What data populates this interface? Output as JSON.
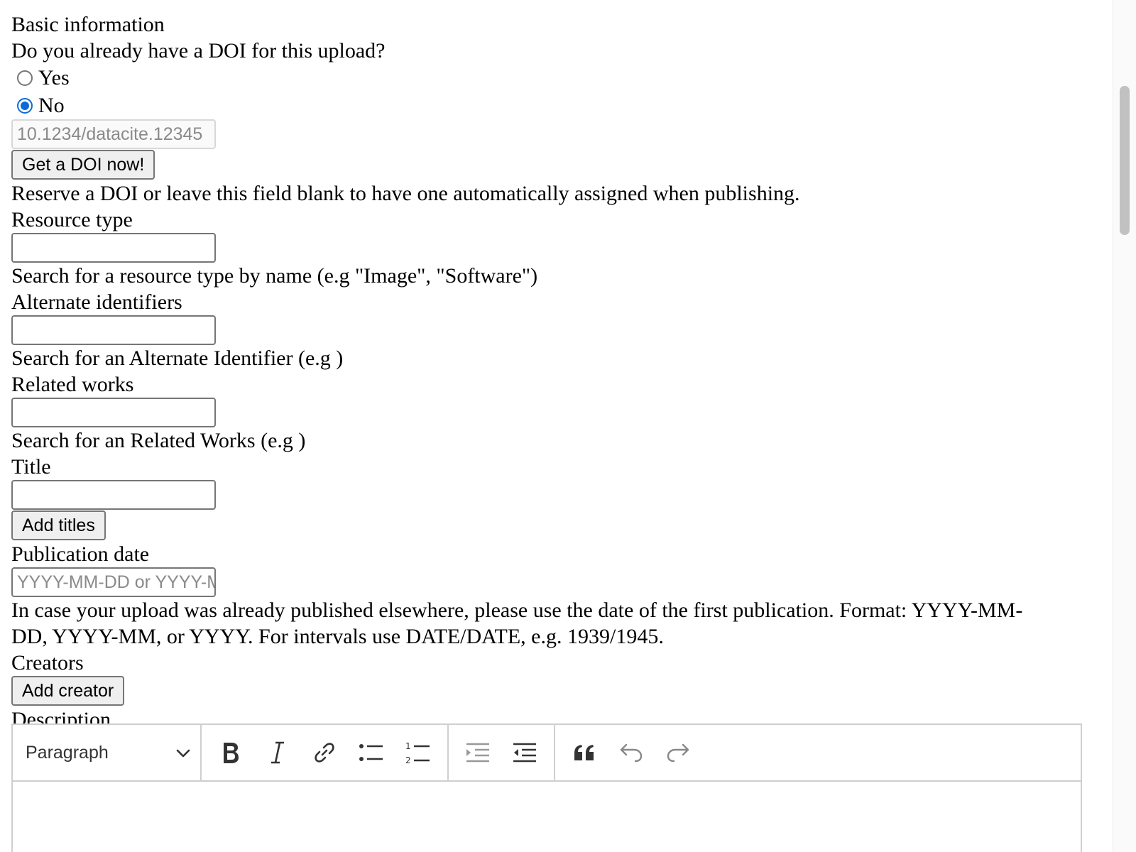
{
  "form": {
    "section_title": "Basic information",
    "doi_question": "Do you already have a DOI for this upload?",
    "doi_options": [
      {
        "label": "Yes",
        "checked": false
      },
      {
        "label": "No",
        "checked": true
      }
    ],
    "doi_placeholder": "10.1234/datacite.12345",
    "get_doi_button": "Get a DOI now!",
    "doi_help": "Reserve a DOI or leave this field blank to have one automatically assigned when publishing.",
    "resource_type_label": "Resource type",
    "resource_type_value": "",
    "resource_type_help": "Search for a resource type by name (e.g \"Image\", \"Software\")",
    "alternate_identifiers_label": "Alternate identifiers",
    "alternate_identifiers_value": "",
    "alternate_identifiers_help": "Search for an Alternate Identifier (e.g )",
    "related_works_label": "Related works",
    "related_works_value": "",
    "related_works_help": "Search for an Related Works (e.g )",
    "title_label": "Title",
    "title_value": "",
    "add_titles_button": "Add titles",
    "publication_date_label": "Publication date",
    "publication_date_placeholder": "YYYY-MM-DD or YYYY-MM-DD/YYYY-MM-DD",
    "publication_date_help_line1": "In case your upload was already published elsewhere, please use the date of the first publication. Format: YYYY-MM-",
    "publication_date_help_line2": "DD, YYYY-MM, or YYYY. For intervals use DATE/DATE, e.g. 1939/1945.",
    "creators_label": "Creators",
    "add_creator_button": "Add creator",
    "description_label": "Description"
  },
  "editor": {
    "heading_select": "Paragraph",
    "toolbar_icons": [
      "bold-icon",
      "italic-icon",
      "link-icon",
      "bulleted-list-icon",
      "numbered-list-icon",
      "indent-icon",
      "outdent-icon",
      "block-quote-icon",
      "undo-icon",
      "redo-icon"
    ],
    "content": ""
  },
  "colors": {
    "accent": "#0b6bd8",
    "border": "#767676",
    "toolbar_icon": "#333333"
  }
}
